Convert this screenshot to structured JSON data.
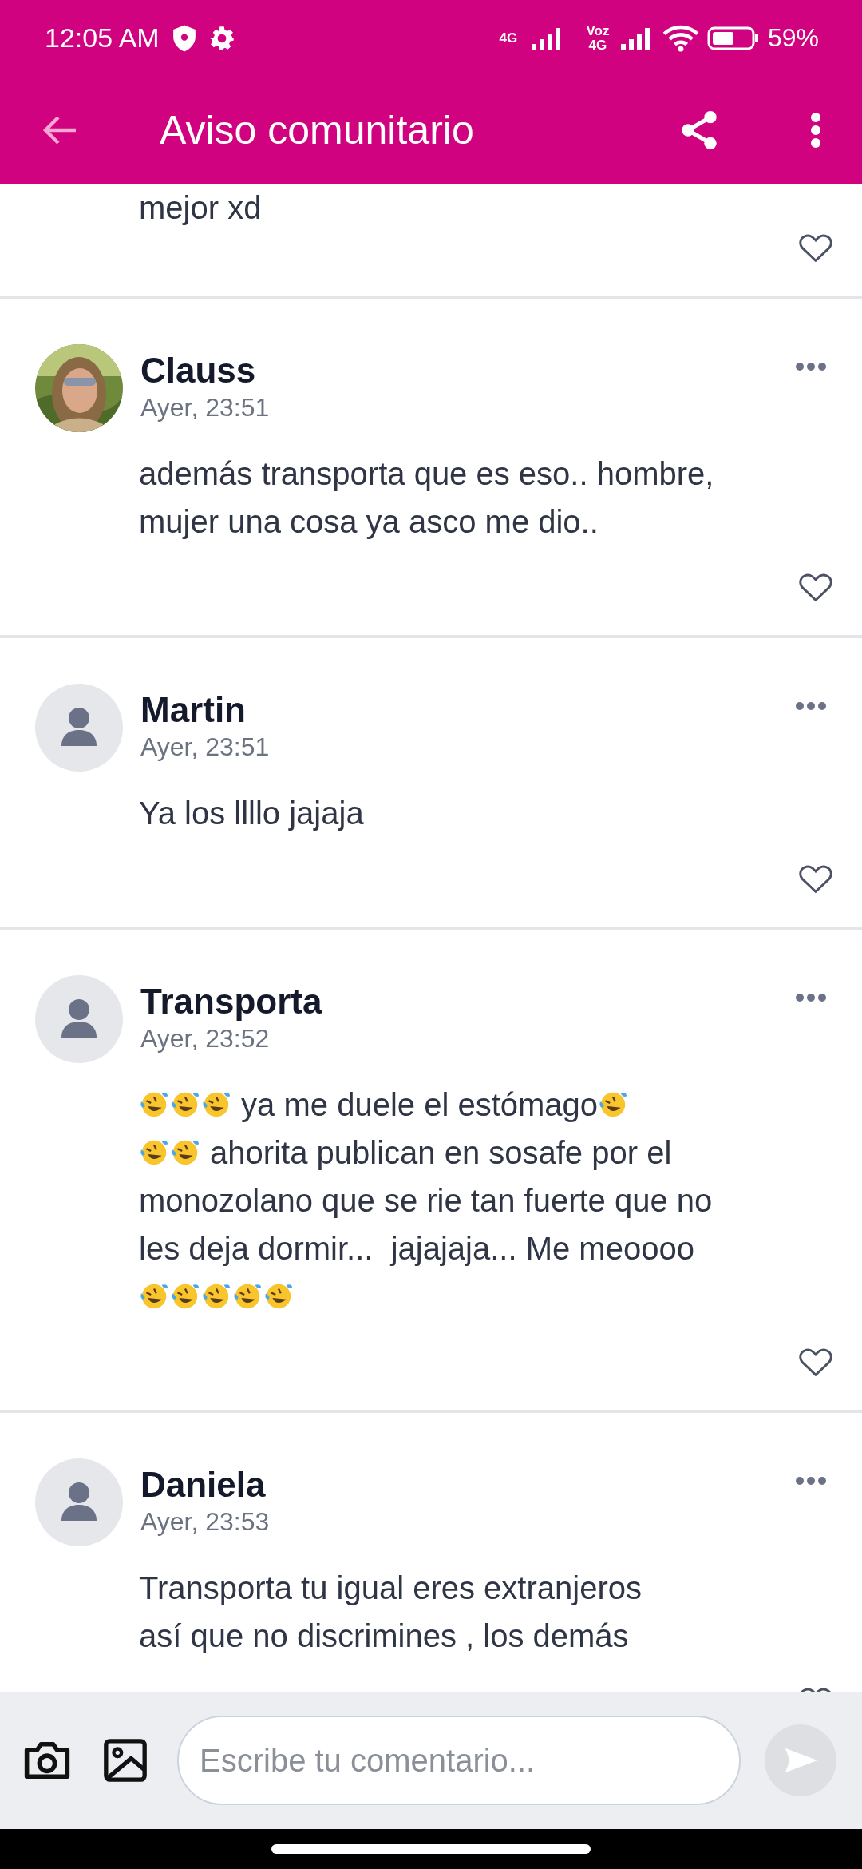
{
  "status_bar": {
    "time": "12:05 AM",
    "network_1": "4G",
    "network_2": "Voz 4G",
    "battery": "59%"
  },
  "app_bar": {
    "title": "Aviso comunitario"
  },
  "comments": [
    {
      "lines": [
        [
          {
            "kind": "text",
            "text": "mejor xd"
          }
        ]
      ]
    },
    {
      "author": "Clauss",
      "time": "Ayer, 23:51",
      "avatar": {
        "kind": "picture"
      },
      "lines": [
        [
          {
            "kind": "text",
            "text": "además transporta que es eso.. hombre,"
          }
        ],
        [
          {
            "kind": "text",
            "text": "mujer una cosa ya asco me dio.."
          }
        ]
      ]
    },
    {
      "author": "Martin",
      "time": "Ayer, 23:51",
      "avatar": {
        "kind": "default"
      },
      "lines": [
        [
          {
            "kind": "text",
            "text": "Ya los llllo jajaja"
          }
        ]
      ]
    },
    {
      "author": "Transporta",
      "time": "Ayer, 23:52",
      "avatar": {
        "kind": "default"
      },
      "lines": [
        [
          {
            "kind": "emoji"
          },
          {
            "kind": "emoji"
          },
          {
            "kind": "emoji"
          },
          {
            "kind": "text",
            "text": " ya me duele el estómago"
          },
          {
            "kind": "emoji"
          }
        ],
        [
          {
            "kind": "emoji"
          },
          {
            "kind": "emoji"
          },
          {
            "kind": "text",
            "text": " ahorita publican en sosafe por el"
          }
        ],
        [
          {
            "kind": "text",
            "text": "monozolano que se rie tan fuerte que no"
          }
        ],
        [
          {
            "kind": "text",
            "text": "les deja dormir...  jajajaja... Me meoooo"
          }
        ],
        [
          {
            "kind": "emoji"
          },
          {
            "kind": "emoji"
          },
          {
            "kind": "emoji"
          },
          {
            "kind": "emoji"
          },
          {
            "kind": "emoji"
          }
        ]
      ]
    },
    {
      "author": "Daniela",
      "time": "Ayer, 23:53",
      "avatar": {
        "kind": "default"
      },
      "lines": [
        [
          {
            "kind": "text",
            "text": "Transporta tu igual eres extranjeros"
          }
        ],
        [
          {
            "kind": "text",
            "text": "así que no discrimines , los demás"
          }
        ]
      ]
    }
  ],
  "composer": {
    "placeholder": "Escribe tu comentario..."
  }
}
